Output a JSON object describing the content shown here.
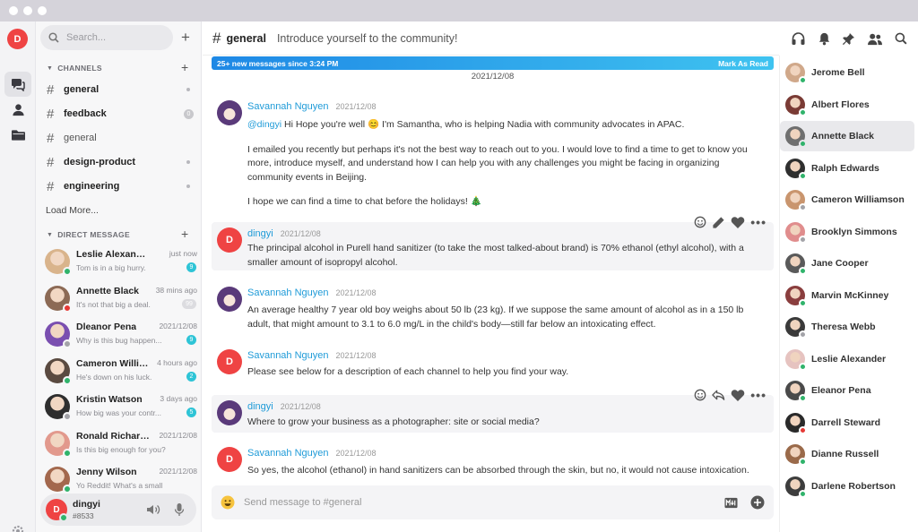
{
  "rail": {
    "logo": "D"
  },
  "sidebar": {
    "search_placeholder": "Search...",
    "channels_header": "CHANNELS",
    "channels": [
      {
        "name": "general",
        "indicator": "dot",
        "count": ""
      },
      {
        "name": "feedback",
        "indicator": "badge",
        "count": "0"
      },
      {
        "name": "general",
        "indicator": "",
        "count": ""
      },
      {
        "name": "design-product",
        "indicator": "dot",
        "count": ""
      },
      {
        "name": "engineering",
        "indicator": "dot",
        "count": ""
      }
    ],
    "load_more": "Load More...",
    "dm_header": "DIRECT MESSAGE",
    "direct_messages": [
      {
        "name": "Leslie Alexander",
        "time": "just now",
        "preview": "Tom is in a big hurry.",
        "badge": "9",
        "status": "on",
        "color": "#d9b48c"
      },
      {
        "name": "Annette Black",
        "time": "38 mins ago",
        "preview": "It's not that big a deal.",
        "badge": "99",
        "status": "busy",
        "color": "#8c6a55"
      },
      {
        "name": "Dleanor Pena",
        "time": "2021/12/08",
        "preview": "Why is this bug happen...",
        "badge": "9",
        "status": "off",
        "color": "#7a4fb0"
      },
      {
        "name": "Cameron Williamson",
        "time": "4 hours ago",
        "preview": "He's down on his luck.",
        "badge": "2",
        "status": "on",
        "color": "#5a4a40"
      },
      {
        "name": "Kristin Watson",
        "time": "3 days ago",
        "preview": "How big was your contr...",
        "badge": "5",
        "status": "off",
        "color": "#2e2e2e"
      },
      {
        "name": "Ronald Richards",
        "time": "2021/12/08",
        "preview": "Is this big enough for you?",
        "badge": "",
        "status": "on",
        "color": "#e2998d"
      },
      {
        "name": "Jenny Wilson",
        "time": "2021/12/08",
        "preview": "Yo Reddit! What's a small",
        "badge": "",
        "status": "on",
        "color": "#a3684d"
      }
    ],
    "user": {
      "initial": "D",
      "name": "dingyi",
      "tag": "#8533"
    }
  },
  "header": {
    "channel": "general",
    "topic": "Introduce yourself to the community!"
  },
  "banner": {
    "text": "25+ new messages since 3:24 PM",
    "action": "Mark As Read"
  },
  "date_divider": "2021/12/08",
  "messages": [
    {
      "author": "Savannah Nguyen",
      "date": "2021/12/08",
      "avatar": "anime",
      "p1_mention": "@dingyi",
      "p1_text": " Hi Hope you're well 😊  I'm Samantha, who is helping Nadia with community advocates in APAC.",
      "p2": "I emailed you recently but perhaps it's not the best way to reach out to you. I would love to find a time to get to know you more, introduce myself, and understand how I can help you with any challenges you might be facing in organizing community events in Beijing.",
      "p3": "I hope we can find a time to chat before the holidays! 🎄"
    },
    {
      "author": "dingyi",
      "date": "2021/12/08",
      "avatar": "D",
      "text": "The principal alcohol in Purell hand sanitizer (to take the most talked-about brand) is 70% ethanol (ethyl alcohol), with a smaller amount of isopropyl alcohol."
    },
    {
      "author": "Savannah Nguyen",
      "date": "2021/12/08",
      "avatar": "anime",
      "text": "An average healthy 7 year old boy weighs about 50 lb (23 kg). If we suppose the same amount of alcohol as in a 150 lb adult, that might amount to 3.1 to 6.0 mg/L in the child's body—still far below an intoxicating effect."
    },
    {
      "author": "Savannah Nguyen",
      "date": "2021/12/08",
      "avatar": "D",
      "text": "Please see below for a description of each channel to help you find your way."
    },
    {
      "author": "dingyi",
      "date": "2021/12/08",
      "avatar": "anime",
      "text": "Where to grow your business as a photographer: site or social media?"
    },
    {
      "author": "Savannah Nguyen",
      "date": "2021/12/08",
      "avatar": "D",
      "text": "So yes, the alcohol (ethanol) in hand sanitizers can be absorbed through the skin, but no, it would not cause intoxication."
    }
  ],
  "composer": {
    "placeholder": "Send message to #general"
  },
  "members": [
    {
      "name": "Jerome Bell",
      "status": "on",
      "color": "#d0a88a"
    },
    {
      "name": "Albert Flores",
      "status": "on",
      "color": "#7a3b35"
    },
    {
      "name": "Annette Black",
      "status": "on",
      "color": "#6f6f6f"
    },
    {
      "name": "Ralph Edwards",
      "status": "on",
      "color": "#2f2f2f"
    },
    {
      "name": "Cameron Williamson",
      "status": "off",
      "color": "#c9956e"
    },
    {
      "name": "Brooklyn Simmons",
      "status": "off",
      "color": "#e08d8d"
    },
    {
      "name": "Jane Cooper",
      "status": "on",
      "color": "#5a5a5a"
    },
    {
      "name": "Marvin McKinney",
      "status": "on",
      "color": "#8a3e3e"
    },
    {
      "name": "Theresa Webb",
      "status": "off",
      "color": "#3a3a3a"
    },
    {
      "name": "Leslie Alexander",
      "status": "on",
      "color": "#e6c3c0"
    },
    {
      "name": "Eleanor Pena",
      "status": "on",
      "color": "#4a4a4a"
    },
    {
      "name": "Darrell Steward",
      "status": "busy",
      "color": "#2a2a2a"
    },
    {
      "name": "Dianne Russell",
      "status": "on",
      "color": "#9a6a4a"
    },
    {
      "name": "Darlene Robertson",
      "status": "on",
      "color": "#3d3d3d"
    }
  ]
}
